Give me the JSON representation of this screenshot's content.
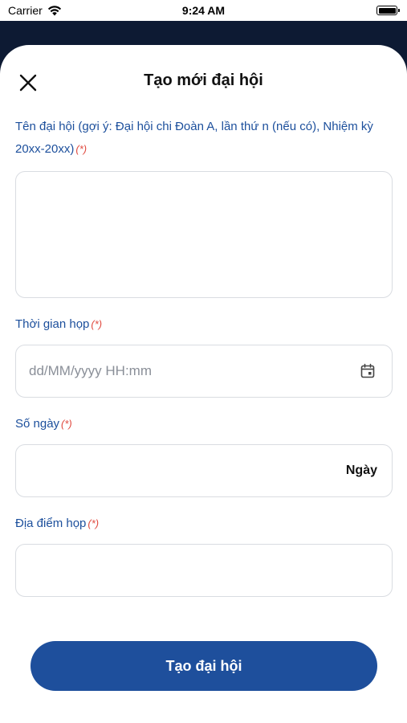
{
  "status_bar": {
    "carrier": "Carrier",
    "time": "9:24 AM"
  },
  "header": {
    "title": "Tạo mới đại hội",
    "close_icon": "close-icon"
  },
  "form": {
    "name": {
      "label": "Tên đại hội (gợi ý: Đại hội chi Đoàn A, lần thứ n (nếu có), Nhiệm kỳ 20xx-20xx)",
      "required_mark": "(*)",
      "value": ""
    },
    "time": {
      "label": "Thời gian họp",
      "required_mark": "(*)",
      "placeholder": "dd/MM/yyyy HH:mm",
      "icon": "calendar-icon"
    },
    "days": {
      "label": "Số ngày",
      "required_mark": "(*)",
      "unit": "Ngày"
    },
    "location": {
      "label": "Địa điểm họp",
      "required_mark": "(*)",
      "value": ""
    }
  },
  "submit_label": "Tạo đại hội",
  "colors": {
    "primary": "#1e4f9c",
    "label": "#1c4f9c",
    "required": "#e04a3f",
    "backdrop": "#0d1a33"
  }
}
